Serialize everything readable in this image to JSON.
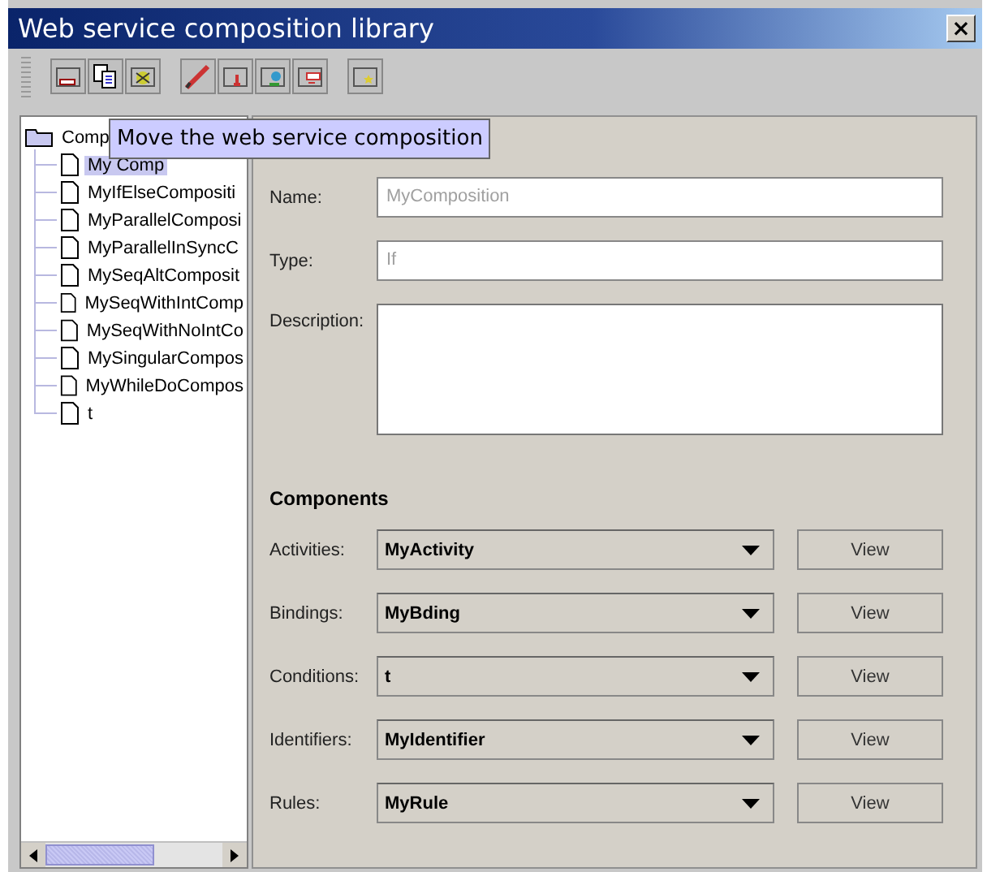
{
  "window": {
    "title": "Web service composition library",
    "close": "×"
  },
  "tooltip": "Move the web service composition",
  "tree": {
    "label": "Comp",
    "expanded": true,
    "children": [
      {
        "label": "My Comp",
        "selected": true
      },
      {
        "label": "MyIfElseCompositi",
        "selected": false
      },
      {
        "label": "MyParallelComposi",
        "selected": false
      },
      {
        "label": "MyParallelInSyncC",
        "selected": false
      },
      {
        "label": "MySeqAltComposit",
        "selected": false
      },
      {
        "label": "MySeqWithIntComp",
        "selected": false
      },
      {
        "label": "MySeqWithNoIntCo",
        "selected": false
      },
      {
        "label": "MySingularCompos",
        "selected": false
      },
      {
        "label": "MyWhileDoCompos",
        "selected": false
      },
      {
        "label": "t",
        "selected": false
      }
    ]
  },
  "form": {
    "fields": [
      {
        "kind": "line",
        "label": "Name:",
        "value": "MyComposition",
        "disabled": true
      },
      {
        "kind": "line",
        "label": "Type:",
        "value": "If",
        "disabled": true
      },
      {
        "kind": "area",
        "label": "Description:"
      }
    ],
    "components_heading": "Components",
    "components": [
      {
        "label": "Activities:",
        "value": "MyActivity",
        "button": "View"
      },
      {
        "label": "Bindings:",
        "value": "MyBding",
        "button": "View"
      },
      {
        "label": "Conditions:",
        "value": "t",
        "button": "View"
      },
      {
        "label": "Identifiers:",
        "value": "MyIdentifier",
        "button": "View"
      },
      {
        "label": "Rules:",
        "value": "MyRule",
        "button": "View"
      }
    ]
  }
}
